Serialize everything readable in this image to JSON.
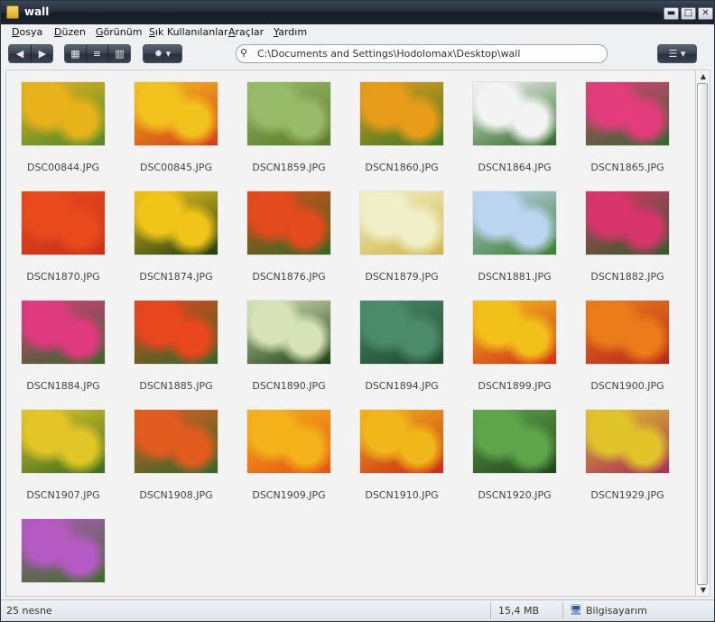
{
  "window": {
    "title": "wall"
  },
  "window_controls": {
    "minimize": "▬",
    "maximize": "□",
    "close": "✕"
  },
  "menu": [
    "Dosya",
    "Düzen",
    "Görünüm",
    "Sık Kullanılanlar",
    "Araçlar",
    "Yardım"
  ],
  "toolbar": {
    "back_icon": "◀",
    "forward_icon": "▶",
    "view_thumbnails_icon": "▦",
    "view_list_icon": "≡",
    "view_columns_icon": "▥",
    "settings_icon": "✹ ▾",
    "menu_icon": "☰ ▾"
  },
  "address": {
    "search_icon": "⚲",
    "path": "C:\\Documents and Settings\\Hodolomax\\Desktop\\wall"
  },
  "scrollbar": {
    "up": "▲",
    "down": "▼"
  },
  "files": [
    {
      "name": "DSC00844.JPG",
      "c1": "#e8b21a",
      "c2": "#4d8a2a"
    },
    {
      "name": "DSC00845.JPG",
      "c1": "#f1c21c",
      "c2": "#d83b16"
    },
    {
      "name": "DSCN1859.JPG",
      "c1": "#98bb69",
      "c2": "#5b7a2a"
    },
    {
      "name": "DSCN1860.JPG",
      "c1": "#e89c1a",
      "c2": "#3f7a22"
    },
    {
      "name": "DSCN1864.JPG",
      "c1": "#f3f3f3",
      "c2": "#2c6b25"
    },
    {
      "name": "DSCN1865.JPG",
      "c1": "#e23d7a",
      "c2": "#2f6a2b"
    },
    {
      "name": "DSCN1870.JPG",
      "c1": "#e84a1b",
      "c2": "#c9321a"
    },
    {
      "name": "DSCN1874.JPG",
      "c1": "#f0c419",
      "c2": "#203f14"
    },
    {
      "name": "DSCN1876.JPG",
      "c1": "#e34a1d",
      "c2": "#2f6b22"
    },
    {
      "name": "DSCN1879.JPG",
      "c1": "#f1efc7",
      "c2": "#d0b94b"
    },
    {
      "name": "DSCN1881.JPG",
      "c1": "#bcd6f2",
      "c2": "#3e7e2e"
    },
    {
      "name": "DSCN1882.JPG",
      "c1": "#d7356b",
      "c2": "#2e5f2a"
    },
    {
      "name": "DSCN1884.JPG",
      "c1": "#e03a7e",
      "c2": "#2f6a29"
    },
    {
      "name": "DSCN1885.JPG",
      "c1": "#e8461c",
      "c2": "#2f6a29"
    },
    {
      "name": "DSCN1890.JPG",
      "c1": "#d7e3b6",
      "c2": "#1d3f16"
    },
    {
      "name": "DSCN1894.JPG",
      "c1": "#4b8a6b",
      "c2": "#1f4b2f"
    },
    {
      "name": "DSCN1899.JPG",
      "c1": "#f2c119",
      "c2": "#d3311a"
    },
    {
      "name": "DSCN1900.JPG",
      "c1": "#ea7d1a",
      "c2": "#b9281c"
    },
    {
      "name": "DSCN1907.JPG",
      "c1": "#e2c627",
      "c2": "#3a6d23"
    },
    {
      "name": "DSCN1908.JPG",
      "c1": "#e25c1f",
      "c2": "#2f6a29"
    },
    {
      "name": "DSCN1909.JPG",
      "c1": "#f4b21a",
      "c2": "#e45616"
    },
    {
      "name": "DSCN1910.JPG",
      "c1": "#f1b619",
      "c2": "#c92e18"
    },
    {
      "name": "DSCN1920.JPG",
      "c1": "#5fa64b",
      "c2": "#22461c"
    },
    {
      "name": "DSCN1929.JPG",
      "c1": "#e1c42a",
      "c2": "#a42e5b"
    },
    {
      "name": "",
      "c1": "#b45ac2",
      "c2": "#3a6d23"
    }
  ],
  "status": {
    "count": "25 nesne",
    "size": "15,4 MB",
    "computer_icon": "🖥",
    "location": "Bilgisayarım"
  }
}
